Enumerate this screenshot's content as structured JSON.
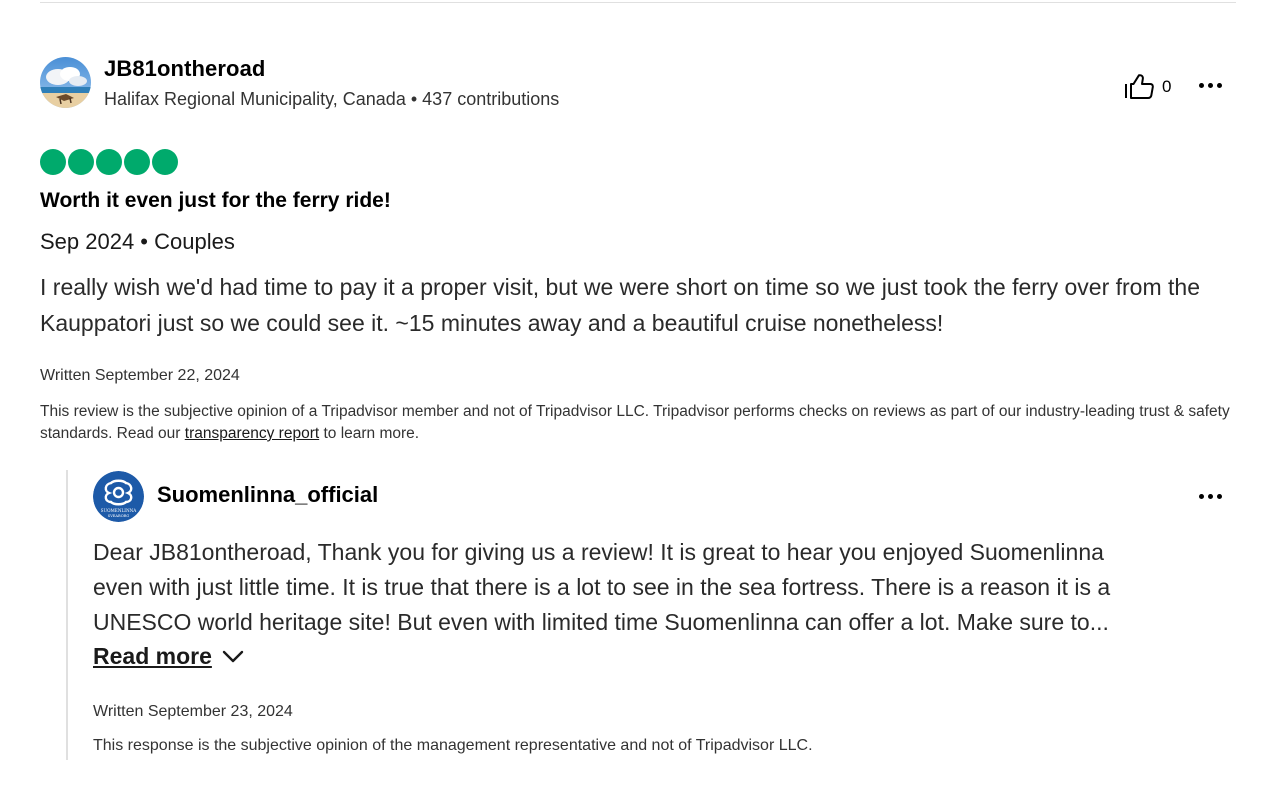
{
  "review": {
    "reviewer": {
      "name": "JB81ontheroad",
      "location": "Halifax Regional Municipality, Canada",
      "separator": "•",
      "contributions": "437 contributions",
      "avatar_icon": "beach-avatar-icon"
    },
    "helpful_count": "0",
    "rating": 5,
    "rating_max": 5,
    "rating_color": "#00aa6c",
    "title": "Worth it even just for the ferry ride!",
    "trip_meta": "Sep 2024 • Couples",
    "body": "I really wish we'd had time to pay it a proper visit, but we were short on time so we just took the ferry over from the Kauppatori just so we could see it. ~15 minutes away and a beautiful cruise nonetheless!",
    "written_date": "Written September 22, 2024",
    "disclaimer_prefix": "This review is the subjective opinion of a Tripadvisor member and not of Tripadvisor LLC. Tripadvisor performs checks on reviews as part of our industry-leading trust & safety standards. Read our ",
    "disclaimer_link": "transparency report",
    "disclaimer_suffix": " to learn more."
  },
  "response": {
    "owner_name": "Suomenlinna_official",
    "owner_avatar_icon": "suomenlinna-logo-icon",
    "avatar_text_top": "SUOMENLINNA",
    "avatar_text_bottom": "SVEABORG",
    "body_lines": [
      "Dear JB81ontheroad, Thank you for giving us a review! It is great to hear you enjoyed Suomenlinna",
      "even with just little time. It is true that there is a lot to see in the sea fortress. There is a reason it is a",
      "UNESCO world heritage site! But even with limited time Suomenlinna can offer a lot. Make sure to..."
    ],
    "read_more_label": "Read more",
    "written_date": "Written September 23, 2024",
    "disclaimer": "This response is the subjective opinion of the management representative and not of Tripadvisor LLC."
  }
}
